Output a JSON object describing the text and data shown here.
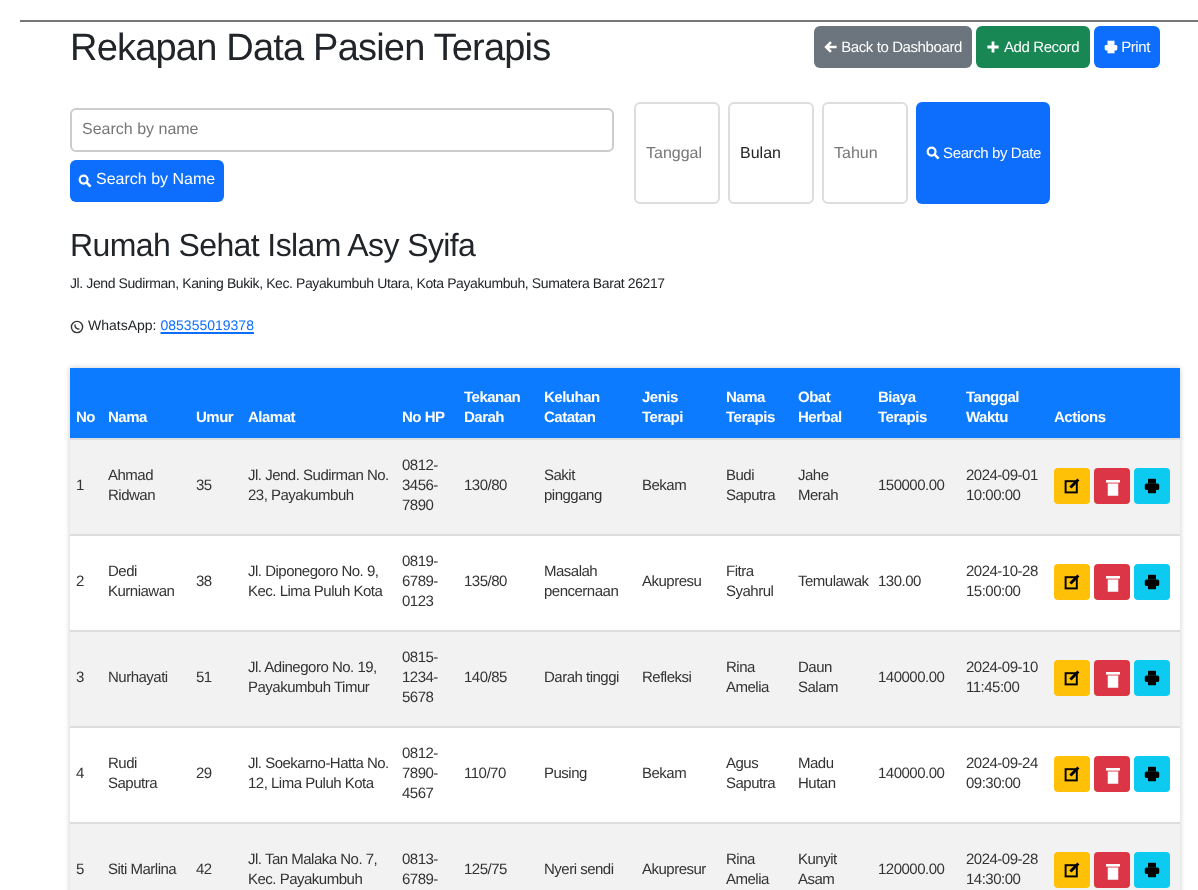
{
  "title": "Rekapan Data Pasien Terapis",
  "header_buttons": [
    {
      "kind": "back",
      "label": "Back to Dashboard"
    },
    {
      "kind": "add",
      "label": "Add Record"
    },
    {
      "kind": "print",
      "label": "Print"
    }
  ],
  "name_search": {
    "placeholder": "Search by name",
    "button": "Search by Name"
  },
  "date_search": {
    "fields": [
      {
        "placeholder": "Tanggal"
      },
      {
        "value": "Bulan"
      },
      {
        "placeholder": "Tahun"
      }
    ],
    "button": "Search by Date"
  },
  "clinic": {
    "name": "Rumah Sehat Islam Asy Syifa",
    "address": "Jl. Jend Sudirman, Kaning Bukik, Kec. Payakumbuh Utara, Kota Payakumbuh, Sumatera Barat 26217",
    "whatsapp_label": "WhatsApp:",
    "whatsapp_number": "085355019378"
  },
  "table": {
    "columns": [
      "No",
      "Nama",
      "Umur",
      "Alamat",
      "No HP",
      "Tekanan Darah",
      "Keluhan Catatan",
      "Jenis Terapi",
      "Nama Terapis",
      "Obat Herbal",
      "Biaya Terapis",
      "Tanggal Waktu",
      "Actions"
    ],
    "rows": [
      {
        "cells": [
          "1",
          "Ahmad Ridwan",
          "35",
          "Jl. Jend. Sudirman No. 23, Payakumbuh",
          "0812-3456-7890",
          "130/80",
          "Sakit pinggang",
          "Bekam",
          "Budi Saputra",
          "Jahe Merah",
          "150000.00",
          "2024-09-01 10:00:00"
        ]
      },
      {
        "cells": [
          "2",
          "Dedi Kurniawan",
          "38",
          "Jl. Diponegoro No. 9, Kec. Lima Puluh Kota",
          "0819-6789-0123",
          "135/80",
          "Masalah pencernaan",
          "Akupresu",
          "Fitra Syahrul",
          "Temulawak",
          "130.00",
          "2024-10-28 15:00:00"
        ]
      },
      {
        "cells": [
          "3",
          "Nurhayati",
          "51",
          "Jl. Adinegoro No. 19, Payakumbuh Timur",
          "0815-1234-5678",
          "140/85",
          "Darah tinggi",
          "Refleksi",
          "Rina Amelia",
          "Daun Salam",
          "140000.00",
          "2024-09-10 11:45:00"
        ]
      },
      {
        "cells": [
          "4",
          "Rudi Saputra",
          "29",
          "Jl. Soekarno-Hatta No. 12, Lima Puluh Kota",
          "0812-7890-4567",
          "110/70",
          "Pusing",
          "Bekam",
          "Agus Saputra",
          "Madu Hutan",
          "140000.00",
          "2024-09-24 09:30:00"
        ]
      },
      {
        "cells": [
          "5",
          "Siti Marlina",
          "42",
          "Jl. Tan Malaka No. 7, Kec. Payakumbuh",
          "0813-6789-",
          "125/75",
          "Nyeri sendi",
          "Akupresur",
          "Rina Amelia",
          "Kunyit Asam",
          "120000.00",
          "2024-09-28 14:30:00"
        ]
      }
    ]
  }
}
